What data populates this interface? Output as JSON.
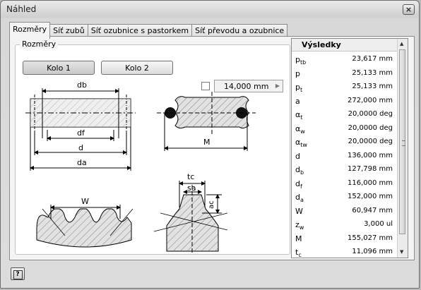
{
  "window": {
    "title": "Náhled",
    "close_label": "×"
  },
  "tabs": [
    {
      "label": "Rozměry"
    },
    {
      "label": "Síť zubů"
    },
    {
      "label": "Síť ozubnice s pastorkem"
    },
    {
      "label": "Síť převodu a ozubnice"
    }
  ],
  "group": {
    "legend": "Rozměry"
  },
  "buttons": {
    "kolo1": "Kolo 1",
    "kolo2": "Kolo 2"
  },
  "spinner": {
    "value": "14,000 mm"
  },
  "diagram_labels": {
    "db": "db",
    "df": "df",
    "d": "d",
    "da": "da",
    "M": "M",
    "W": "W",
    "tc": "tc",
    "sa": "sa",
    "ac": "ac"
  },
  "results": {
    "header": "Výsledky",
    "rows": [
      {
        "name": "p",
        "sub": "tb",
        "value": "23,617 mm"
      },
      {
        "name": "p",
        "sub": "",
        "value": "25,133 mm"
      },
      {
        "name": "p",
        "sub": "t",
        "value": "25,133 mm"
      },
      {
        "name": "a",
        "sub": "",
        "value": "272,000 mm"
      },
      {
        "name": "α",
        "sub": "t",
        "value": "20,0000 deg"
      },
      {
        "name": "α",
        "sub": "w",
        "value": "20,0000 deg"
      },
      {
        "name": "α",
        "sub": "tw",
        "value": "20,0000 deg"
      },
      {
        "name": "d",
        "sub": "",
        "value": "136,000 mm"
      },
      {
        "name": "d",
        "sub": "b",
        "value": "127,798 mm"
      },
      {
        "name": "d",
        "sub": "f",
        "value": "116,000 mm"
      },
      {
        "name": "d",
        "sub": "a",
        "value": "152,000 mm"
      },
      {
        "name": "W",
        "sub": "",
        "value": "60,947 mm"
      },
      {
        "name": "z",
        "sub": "w",
        "value": "3,000 ul"
      },
      {
        "name": "M",
        "sub": "",
        "value": "155,027 mm"
      },
      {
        "name": "t",
        "sub": "c",
        "value": "11,096 mm"
      }
    ]
  },
  "help": {
    "label": "?"
  }
}
